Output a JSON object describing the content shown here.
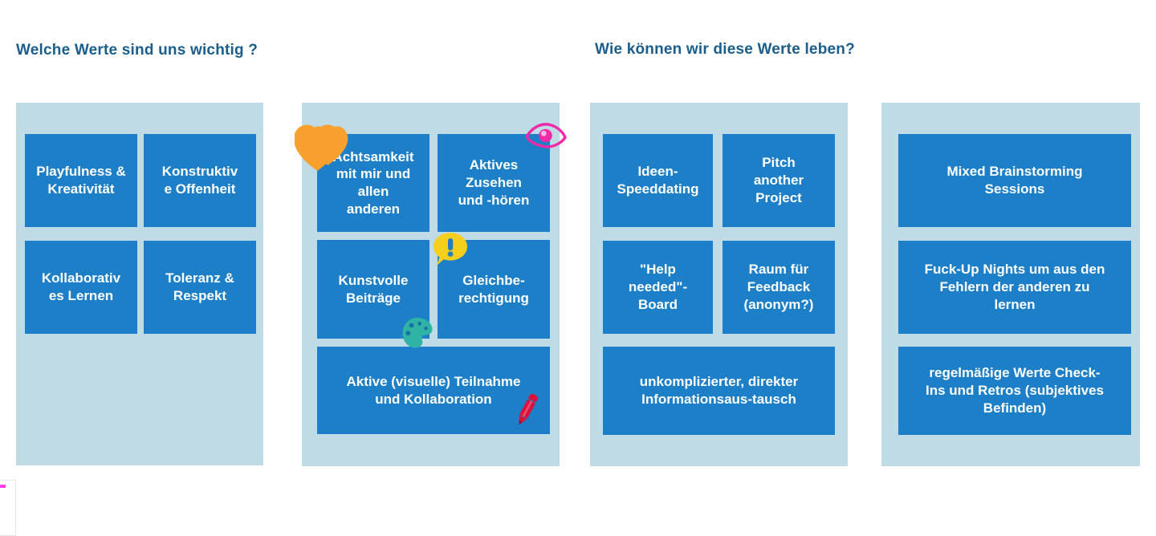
{
  "headings": {
    "left": "Welche Werte sind uns wichtig ?",
    "right": "Wie können wir diese Werte leben?"
  },
  "colors": {
    "heading": "#1b5e8c",
    "panel": "#bfdce6",
    "card": "#1c7fc8",
    "card_text": "#ffffff",
    "heart": "#f9a12e",
    "eye": "#ef2ba8",
    "bubble": "#f5cf1b",
    "palette": "#2fb3a4",
    "pencil": "#d9123c",
    "edge_bar": "#ff3df0"
  },
  "columns": [
    {
      "id": "values-column-1",
      "cards": [
        {
          "id": "card-playfulness-kreativitaet",
          "text": "Playfulness &\nKreativität"
        },
        {
          "id": "card-konstruktive-offenheit",
          "text": "Konstruktiv\ne Offenheit"
        },
        {
          "id": "card-kollaboratives-lernen",
          "text": "Kollaborativ\nes Lernen"
        },
        {
          "id": "card-toleranz-respekt",
          "text": "Toleranz &\nRespekt"
        }
      ]
    },
    {
      "id": "values-column-2",
      "cards": [
        {
          "id": "card-achtsamkeit",
          "text": "Achtsamkeit\nmit mir und\nallen\nanderen"
        },
        {
          "id": "card-aktives-zusehen",
          "text": "Aktives\nZusehen\nund -hören"
        },
        {
          "id": "card-kunstvolle-beitraege",
          "text": "Kunstvolle\nBeiträge"
        },
        {
          "id": "card-gleichberechtigung",
          "text": "Gleichbe-\nrechtigung"
        },
        {
          "id": "card-aktive-teilnahme",
          "text": "Aktive (visuelle) Teilnahme\nund Kollaboration"
        }
      ]
    },
    {
      "id": "practices-column-1",
      "cards": [
        {
          "id": "card-ideen-speeddating",
          "text": "Ideen-\nSpeeddating"
        },
        {
          "id": "card-pitch-another-project",
          "text": "Pitch\nanother\nProject"
        },
        {
          "id": "card-help-needed-board",
          "text": "\"Help\nneeded\"-\nBoard"
        },
        {
          "id": "card-raum-fuer-feedback",
          "text": "Raum für\nFeedback\n(anonym?)"
        },
        {
          "id": "card-informationsaustausch",
          "text": "unkomplizierter, direkter\nInformationsaus-tausch"
        }
      ]
    },
    {
      "id": "practices-column-2",
      "cards": [
        {
          "id": "card-mixed-brainstorming",
          "text": "Mixed Brainstorming\nSessions"
        },
        {
          "id": "card-fuck-up-nights",
          "text": "Fuck-Up Nights um aus den\nFehlern der anderen zu\nlernen"
        },
        {
          "id": "card-werte-check-ins",
          "text": "regelmäßige Werte Check-\nIns und Retros (subjektives\nBefinden)"
        }
      ]
    }
  ],
  "stickers": [
    {
      "id": "hearts-icon",
      "name": "two-hearts"
    },
    {
      "id": "eye-icon",
      "name": "eye"
    },
    {
      "id": "bubble-icon",
      "name": "speech-bubble-exclamation"
    },
    {
      "id": "palette-icon",
      "name": "artist-palette"
    },
    {
      "id": "pencil-icon",
      "name": "pencil"
    }
  ]
}
